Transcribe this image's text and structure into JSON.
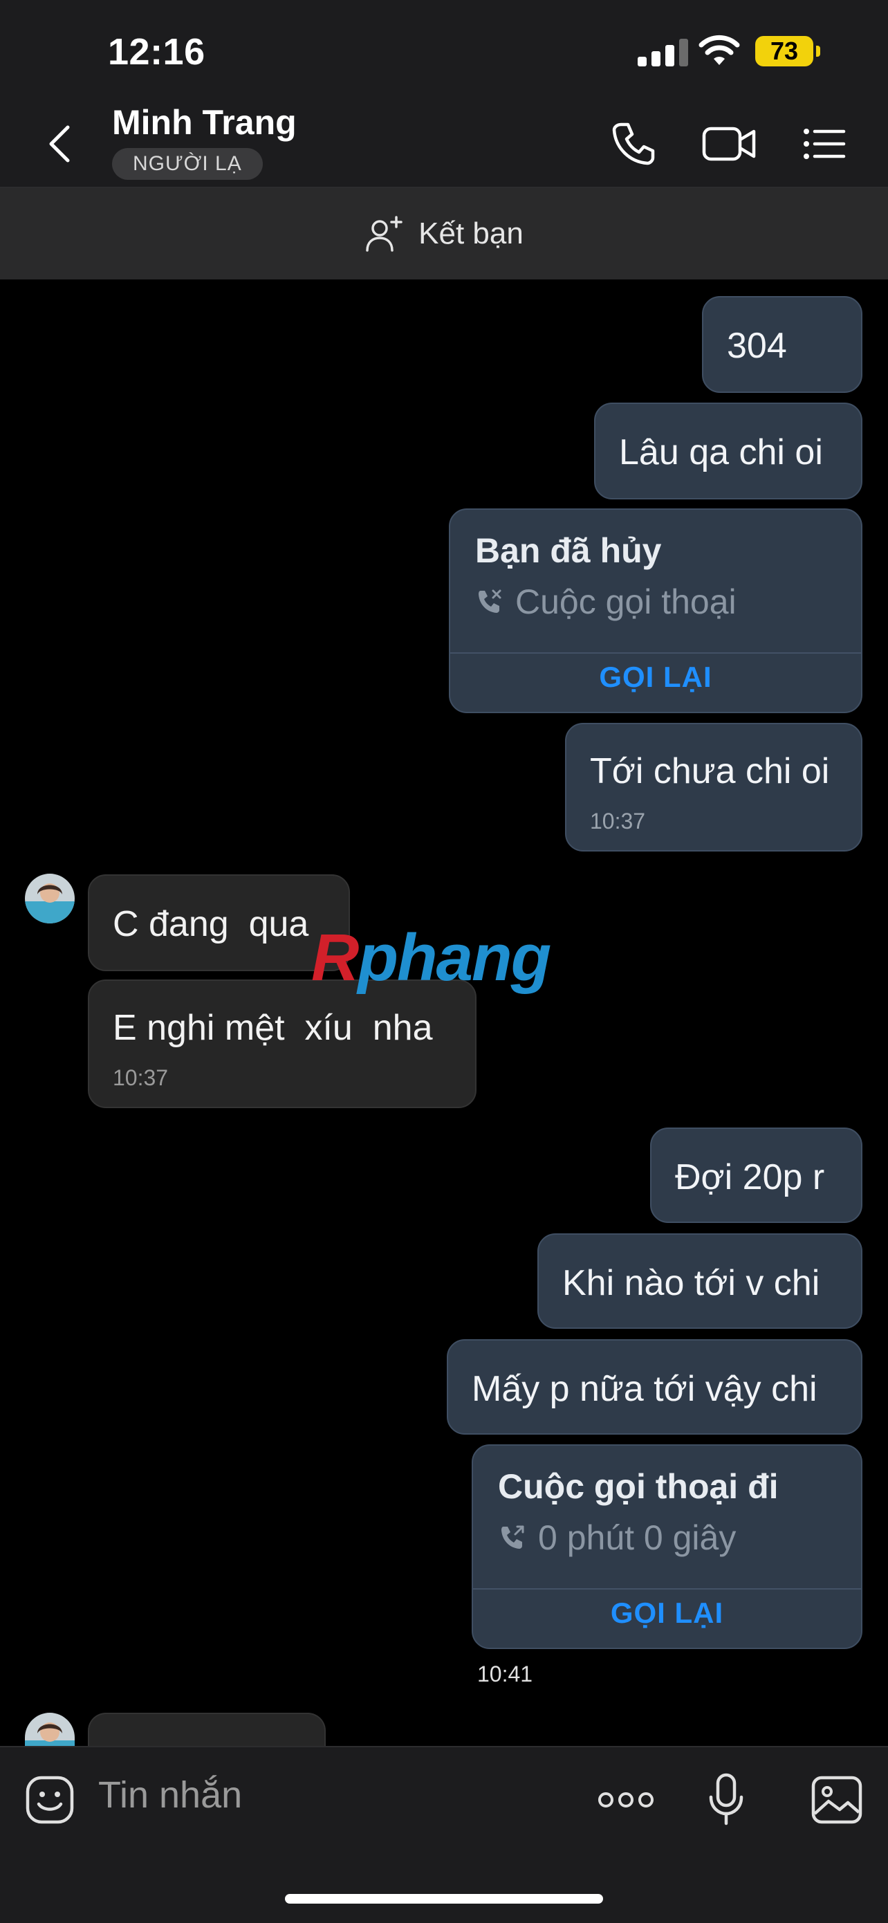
{
  "status_bar": {
    "time": "12:16",
    "battery": "73",
    "icons": [
      "signal-icon",
      "wifi-icon",
      "battery-icon"
    ]
  },
  "header": {
    "name": "Minh Trang",
    "badge": "NGƯỜI LẠ",
    "icons": [
      "back-icon",
      "phone-icon",
      "video-call-icon",
      "menu-list-icon"
    ]
  },
  "add_friend": {
    "label": "Kết bạn",
    "icon": "add-user-icon"
  },
  "messages": {
    "m1": "304",
    "m2": "Lâu qa chi oi",
    "call1": {
      "title": "Bạn đã hủy",
      "subtitle": "Cuộc gọi thoại",
      "action": "GỌI LẠI",
      "icon": "missed-call-icon"
    },
    "m3": {
      "text": "Tới chưa chi oi",
      "time": "10:37"
    },
    "m4": "C đang  qua",
    "m5": {
      "text": "E nghi mệt  xíu  nha",
      "time": "10:37"
    },
    "m6": "Đợi 20p r",
    "m7": "Khi nào tới v chi",
    "m8": "Mấy p nữa tới vậy chi",
    "call2": {
      "title": "Cuộc gọi thoại đi",
      "subtitle": "0 phút 0 giây",
      "action": "GỌI LẠI",
      "time": "10:41",
      "icon": "outgoing-call-icon"
    }
  },
  "watermark": {
    "part1": "R",
    "part2": "phang"
  },
  "composer": {
    "placeholder": "Tin nhắn",
    "icons": [
      "sticker-icon",
      "more-icon",
      "microphone-icon",
      "image-icon"
    ]
  },
  "colors": {
    "accent": "#1f8fff",
    "outgoing_bubble": "#2f3b4a",
    "incoming_bubble": "#262626",
    "battery": "#f2d20c"
  }
}
